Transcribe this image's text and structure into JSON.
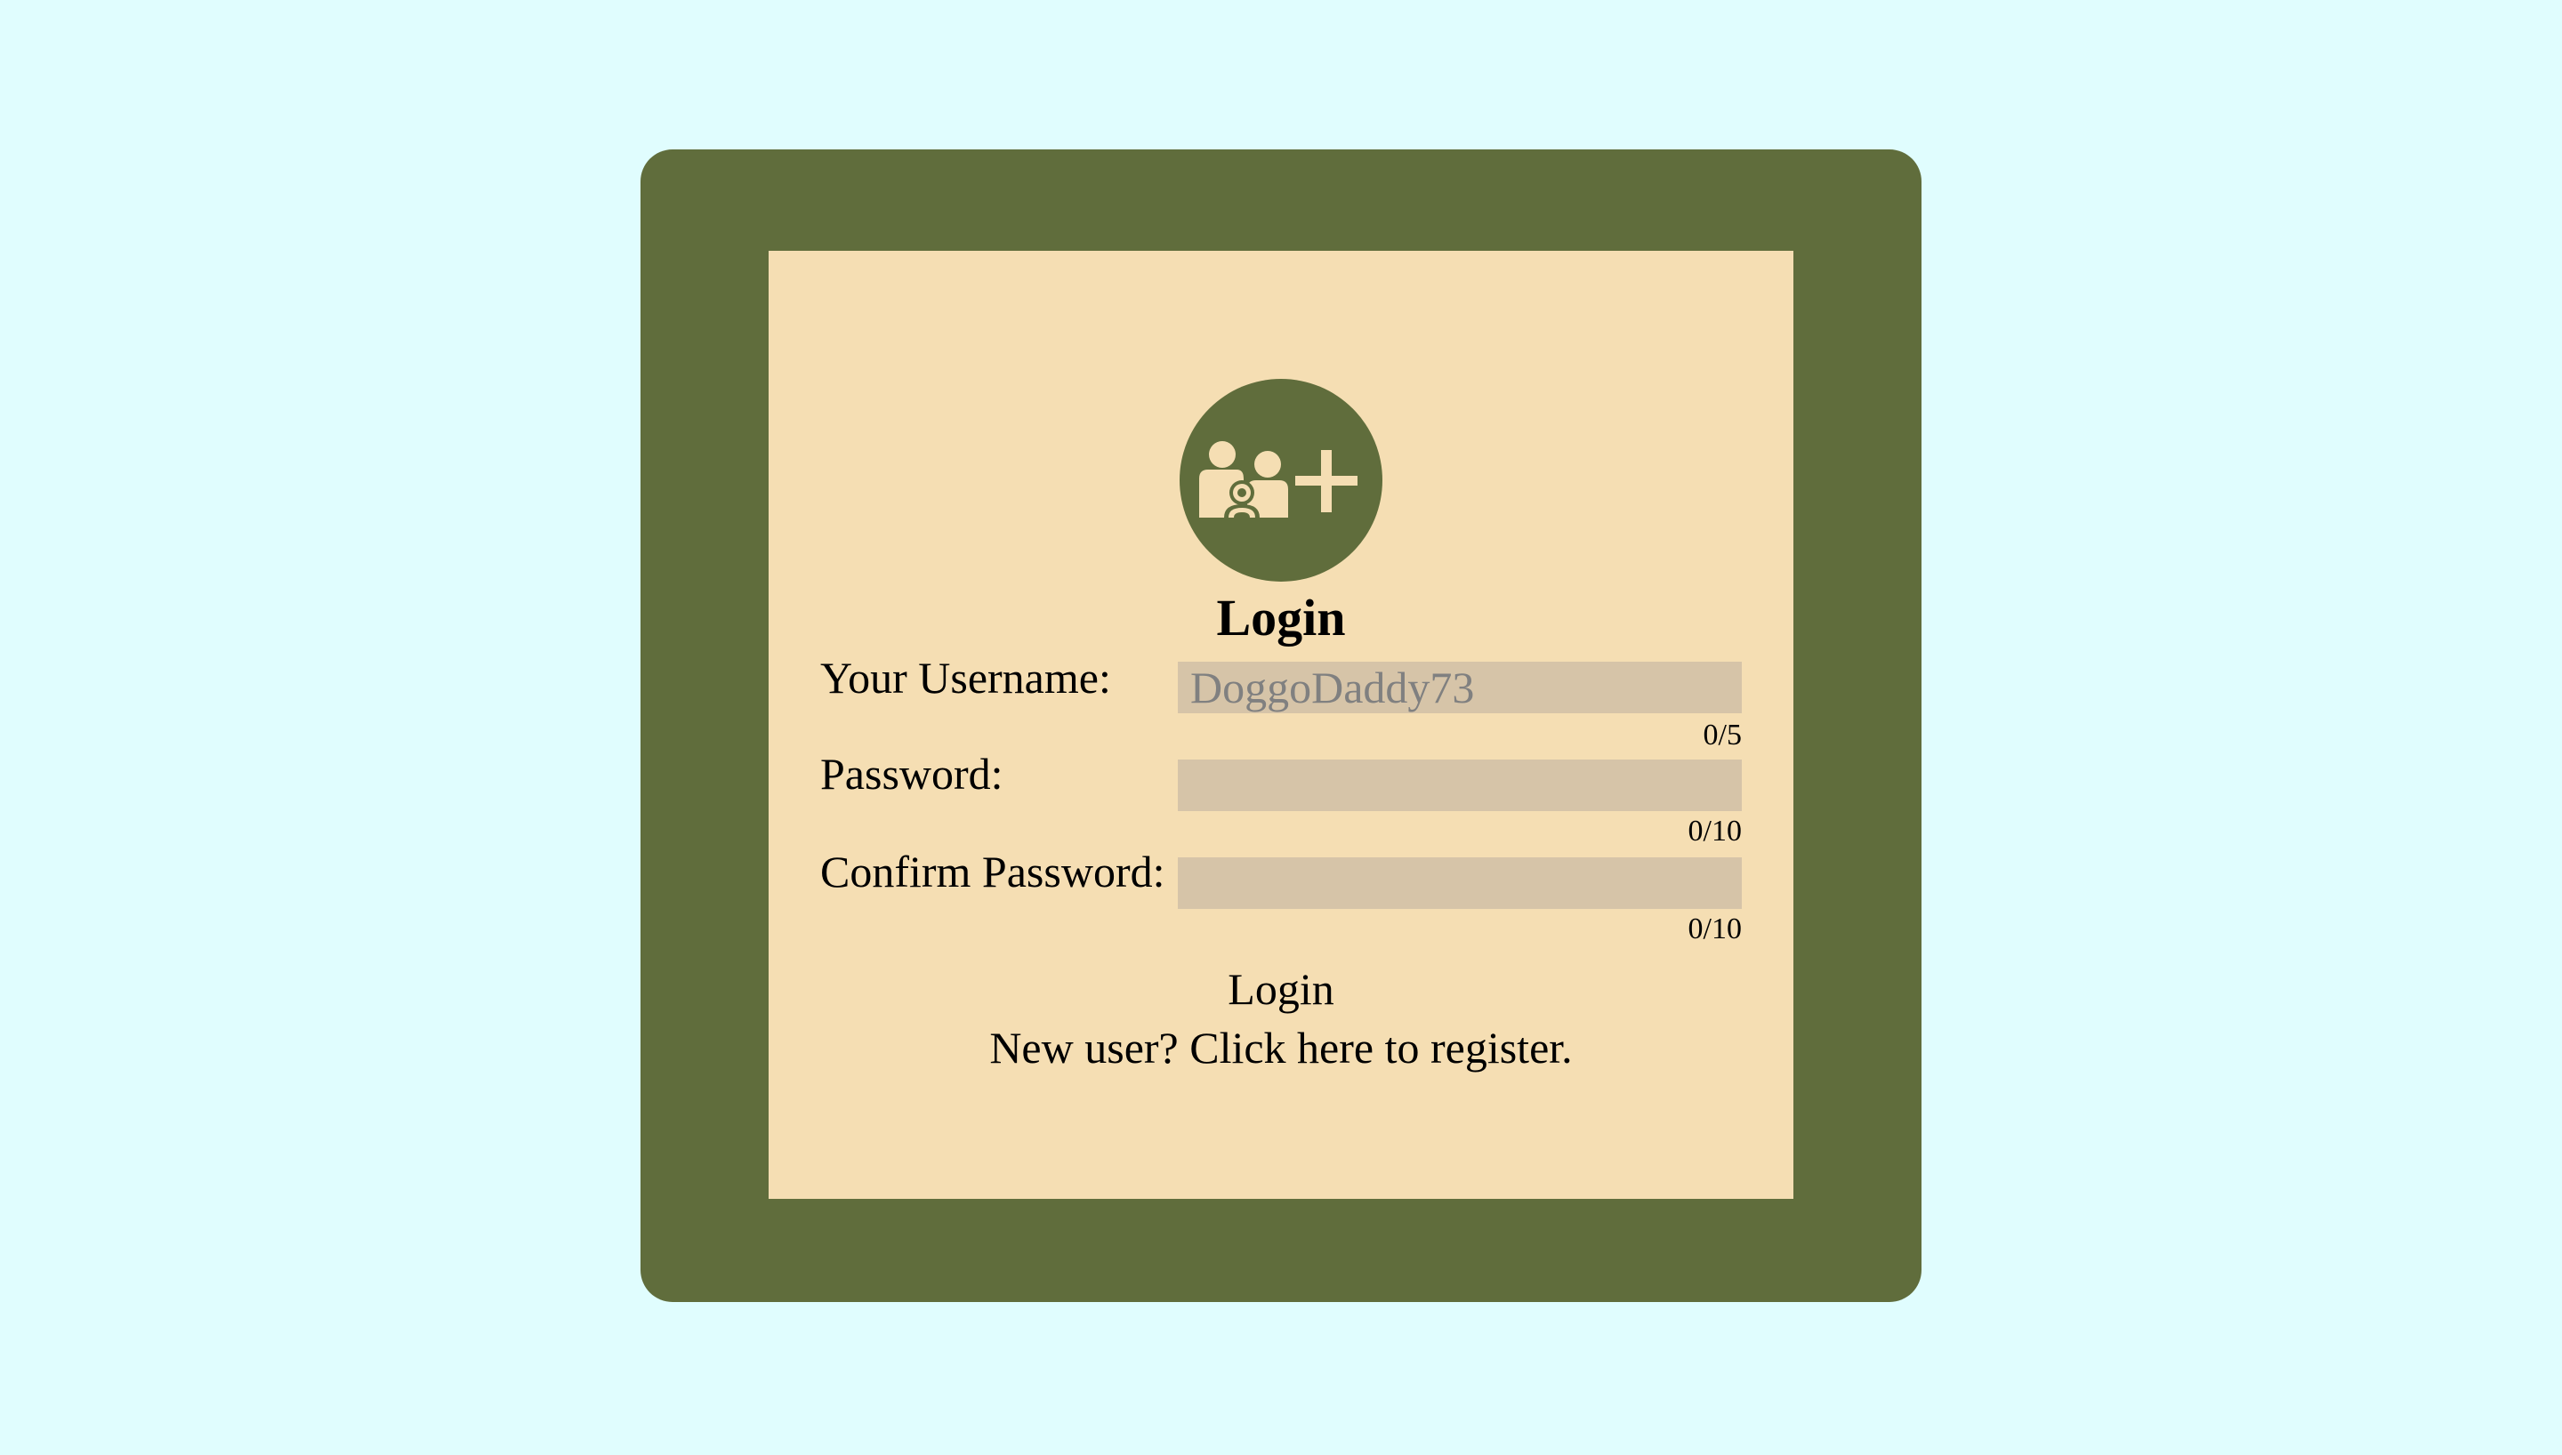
{
  "colors": {
    "background": "#e0fdfe",
    "card": "#606d3c",
    "panel": "#f5deb3",
    "input_fill": "#d6c4a8",
    "icon": "#f5deb3"
  },
  "avatar": {
    "icon": "family-add-icon"
  },
  "form": {
    "title": "Login",
    "username": {
      "label": "Your Username:",
      "value": "",
      "placeholder": "DoggoDaddy73",
      "counter": "0/5"
    },
    "password": {
      "label": "Password:",
      "value": "",
      "placeholder": "",
      "counter": "0/10"
    },
    "confirm_password": {
      "label": "Confirm Password:",
      "value": "",
      "placeholder": "",
      "counter": "0/10"
    },
    "submit_label": "Login",
    "register_text": "New user? Click here to register."
  }
}
